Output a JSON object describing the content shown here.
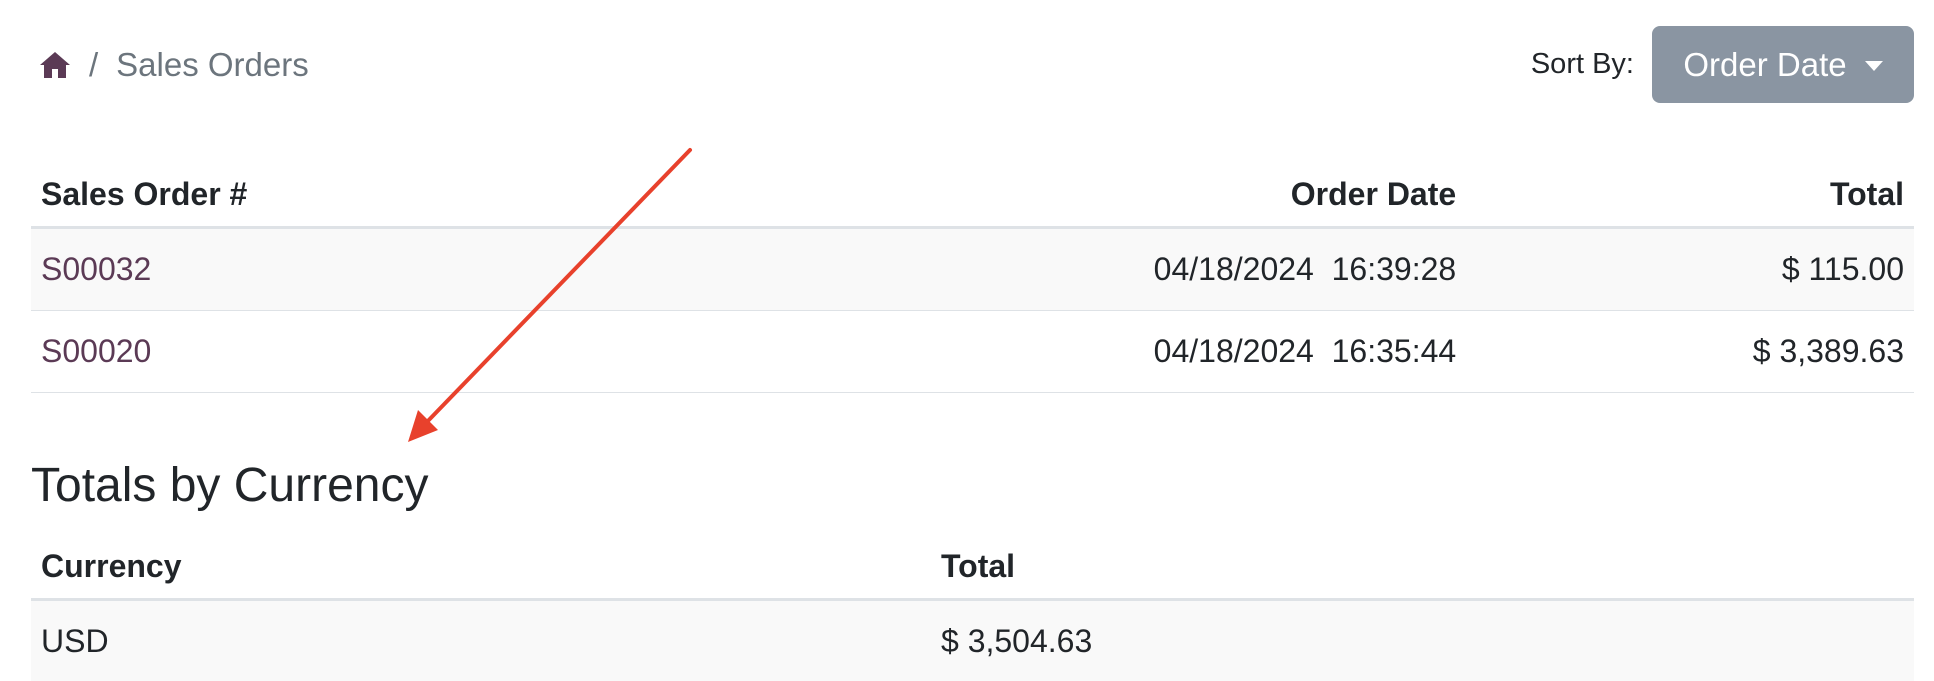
{
  "breadcrumb": {
    "separator": "/",
    "current": "Sales Orders"
  },
  "sort": {
    "label": "Sort By:",
    "selected": "Order Date"
  },
  "orders_table": {
    "headers": [
      "Sales Order #",
      "Order Date",
      "Total"
    ],
    "rows": [
      {
        "order": "S00032",
        "date": "04/18/2024  16:39:28",
        "total": "$ 115.00"
      },
      {
        "order": "S00020",
        "date": "04/18/2024  16:35:44",
        "total": "$ 3,389.63"
      }
    ]
  },
  "totals_section": {
    "title": "Totals by Currency",
    "headers": [
      "Currency",
      "Total"
    ],
    "rows": [
      {
        "currency": "USD",
        "total": "$ 3,504.63"
      }
    ]
  },
  "icons": {
    "home": "home-icon",
    "caret": "caret-down-icon"
  },
  "colors": {
    "link": "#5b3a55",
    "button": "#8a95a2",
    "arrow": "#e8412c"
  }
}
